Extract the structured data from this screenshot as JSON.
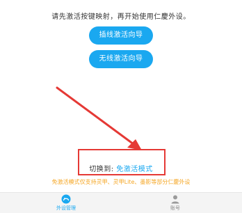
{
  "instruction": "请先激活按键映射，再开始使用仁慶外设。",
  "buttons": {
    "wired": "插线激活向导",
    "wireless": "无线激活向导"
  },
  "switch": {
    "label": "切换到:",
    "link": "免激活模式"
  },
  "warning": "免激活模式仅支持灵甲、灵甲Lite、墨影等部分仁慶外设",
  "tabbar": {
    "devices": "外设管理",
    "account": "账号"
  },
  "colors": {
    "accent": "#1aa8f0",
    "highlight_box": "#e53935",
    "warning": "#f5a623"
  }
}
